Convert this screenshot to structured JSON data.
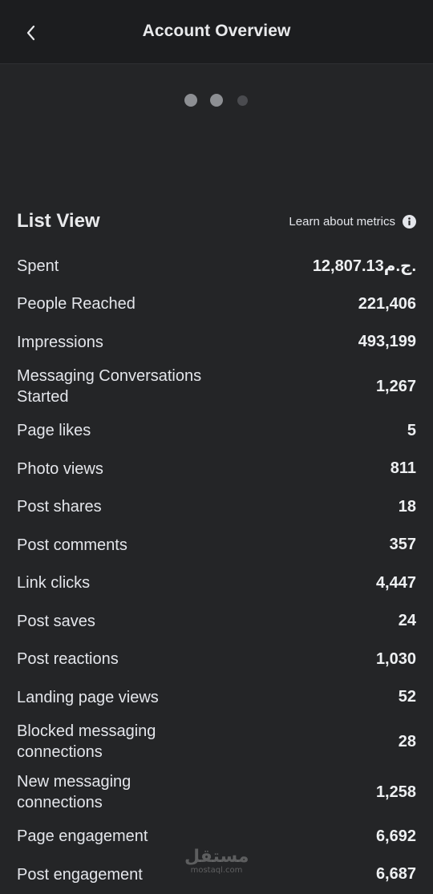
{
  "header": {
    "title": "Account Overview",
    "back_icon": "chevron-left-icon"
  },
  "pager": {
    "pages": 3,
    "active_index": 0
  },
  "list": {
    "title": "List View",
    "learn_label": "Learn about metrics",
    "info_icon": "info-icon",
    "rows": [
      {
        "label": "Spent",
        "value": "12,807.13ج.م."
      },
      {
        "label": "People Reached",
        "value": "221,406"
      },
      {
        "label": "Impressions",
        "value": "493,199"
      },
      {
        "label": "Messaging Conversations Started",
        "value": "1,267"
      },
      {
        "label": "Page likes",
        "value": "5"
      },
      {
        "label": "Photo views",
        "value": "811"
      },
      {
        "label": "Post shares",
        "value": "18"
      },
      {
        "label": "Post comments",
        "value": "357"
      },
      {
        "label": "Link clicks",
        "value": "4,447"
      },
      {
        "label": "Post saves",
        "value": "24"
      },
      {
        "label": "Post reactions",
        "value": "1,030"
      },
      {
        "label": "Landing page views",
        "value": "52"
      },
      {
        "label": "Blocked messaging connections",
        "value": "28"
      },
      {
        "label": "New messaging connections",
        "value": "1,258"
      },
      {
        "label": "Page engagement",
        "value": "6,692"
      },
      {
        "label": "Post engagement",
        "value": "6,687"
      }
    ]
  },
  "watermark": {
    "arabic": "مستقل",
    "latin": "mostaql.com"
  }
}
